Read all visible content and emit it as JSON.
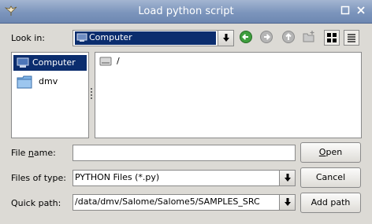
{
  "window": {
    "title": "Load python script",
    "minimize_icon": "minimize-icon",
    "close_icon": "close-icon"
  },
  "toolbar": {
    "look_in_label_pre": "Look in:",
    "look_in_value": "Computer",
    "icons": [
      "back-icon",
      "forward-icon",
      "up-icon",
      "new-folder-icon",
      "list-view-icon",
      "detail-view-icon"
    ]
  },
  "sidebar": {
    "items": [
      {
        "label": "Computer",
        "icon": "computer-icon",
        "selected": true
      },
      {
        "label": "dmv",
        "icon": "folder-icon",
        "selected": false
      }
    ]
  },
  "files": {
    "items": [
      {
        "label": "/",
        "icon": "drive-icon"
      }
    ]
  },
  "form": {
    "file_name_label_pre": "File ",
    "file_name_label_u": "n",
    "file_name_label_post": "ame:",
    "file_name_value": "",
    "files_of_type_label": "Files of type:",
    "files_of_type_value": "PYTHON Files (*.py)",
    "quick_path_label": "Quick path:",
    "quick_path_value": "/data/dmv/Salome/Salome5/SAMPLES_SRC"
  },
  "buttons": {
    "open_u": "O",
    "open_rest": "pen",
    "cancel": "Cancel",
    "add_path": "Add path"
  }
}
